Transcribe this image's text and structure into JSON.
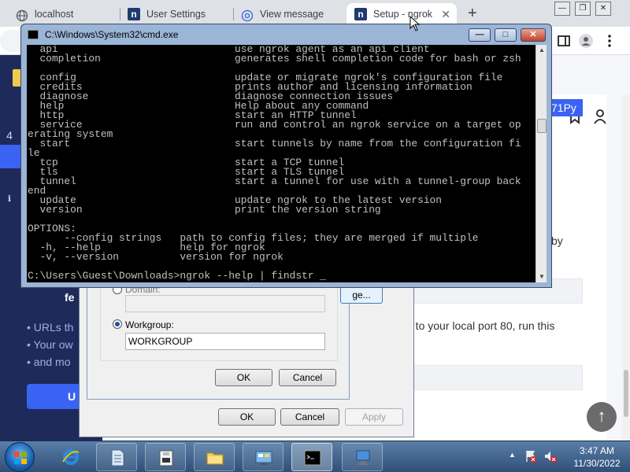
{
  "browser": {
    "tabs": [
      {
        "title": "localhost",
        "icon": "globe-icon"
      },
      {
        "title": "User Settings",
        "icon": "ngrok-icon"
      },
      {
        "title": "View message",
        "icon": "at-sign-icon"
      },
      {
        "title": "Setup - ngrok",
        "icon": "ngrok-icon",
        "active": true
      }
    ],
    "new_tab": "+",
    "tab_close": "✕",
    "favicon_letter": "n"
  },
  "webpage": {
    "token_fragment": "71Py",
    "left_headline": "fe",
    "left_bullets": [
      "URLs th",
      "Your ow",
      "and mo"
    ],
    "left_button": "U",
    "by_text": "by",
    "local_port_text": "g to your local port 80, run this",
    "scroll_top": "↑",
    "side_numbers": [
      "4"
    ]
  },
  "member_dialog": {
    "domain_label": "Domain:",
    "domain_value": "",
    "workgroup_label": "Workgroup:",
    "workgroup_value": "WORKGROUP",
    "ok": "OK",
    "cancel": "Cancel",
    "more_button": "ge..."
  },
  "system_props": {
    "ok": "OK",
    "cancel": "Cancel",
    "apply": "Apply"
  },
  "cmd": {
    "title": "C:\\Windows\\System32\\cmd.exe",
    "min": "—",
    "max": "□",
    "close": "✕",
    "lines": [
      "  api                             use ngrok agent as an api client",
      "  completion                      generates shell completion code for bash or zsh",
      "",
      "  config                          update or migrate ngrok's configuration file",
      "  credits                         prints author and licensing information",
      "  diagnose                        diagnose connection issues",
      "  help                            Help about any command",
      "  http                            start an HTTP tunnel",
      "  service                         run and control an ngrok service on a target op",
      "erating system",
      "  start                           start tunnels by name from the configuration fi",
      "le",
      "  tcp                             start a TCP tunnel",
      "  tls                             start a TLS tunnel",
      "  tunnel                          start a tunnel for use with a tunnel-group back",
      "end",
      "  update                          update ngrok to the latest version",
      "  version                         print the version string",
      "",
      "OPTIONS:",
      "      --config strings   path to config files; they are merged if multiple",
      "  -h, --help             help for ngrok",
      "  -v, --version          version for ngrok",
      "",
      "C:\\Users\\Guest\\Downloads>ngrok --help | findstr _"
    ]
  },
  "taskbar": {
    "items": [
      "ie-icon",
      "notepad-doc-icon",
      "floppy-icon",
      "folder-icon",
      "control-panel-icon",
      "cmd-icon",
      "network-computer-icon"
    ],
    "tray_icons": [
      "flag-alert-icon",
      "volume-muted-icon"
    ],
    "time": "3:47 AM",
    "date": "11/30/2022",
    "show_hidden": "▲"
  },
  "colors": {
    "accent": "#3b63f3",
    "sidebar": "#1e2a5a",
    "console_bg": "#000000",
    "console_fg": "#c0c0c0"
  }
}
